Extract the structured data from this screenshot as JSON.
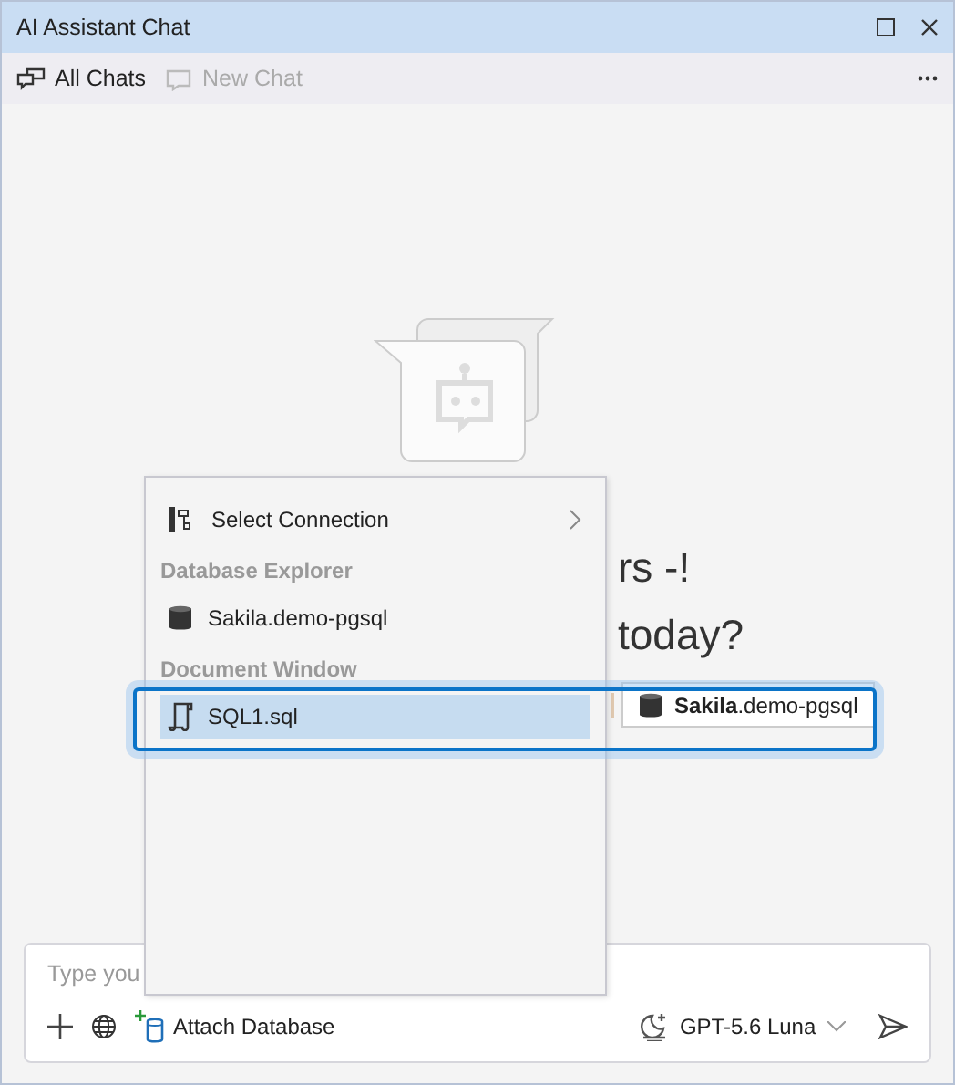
{
  "window": {
    "title": "AI Assistant Chat"
  },
  "toolbar": [
    {
      "label": "All Chats",
      "disabled": false
    },
    {
      "label": "New Chat",
      "disabled": true
    }
  ],
  "welcome": {
    "lines": [
      "rs -!",
      "today?"
    ]
  },
  "context": {
    "chip": "**Sakila**.demo-pgsql"
  },
  "popup": {
    "items": [
      {
        "kind": "submenu",
        "label": "Select Connection"
      },
      {
        "kind": "header",
        "label": "Database Explorer"
      },
      {
        "kind": "database",
        "label": "Sakila.demo-pgsql",
        "selected": false
      },
      {
        "kind": "header",
        "label": "Document Window"
      },
      {
        "kind": "document",
        "label": "SQL1.sql",
        "selected": true
      }
    ]
  },
  "input": {
    "placeholder": "Type you",
    "attach_label": "Attach Database",
    "model": "GPT-5.6 Luna"
  }
}
